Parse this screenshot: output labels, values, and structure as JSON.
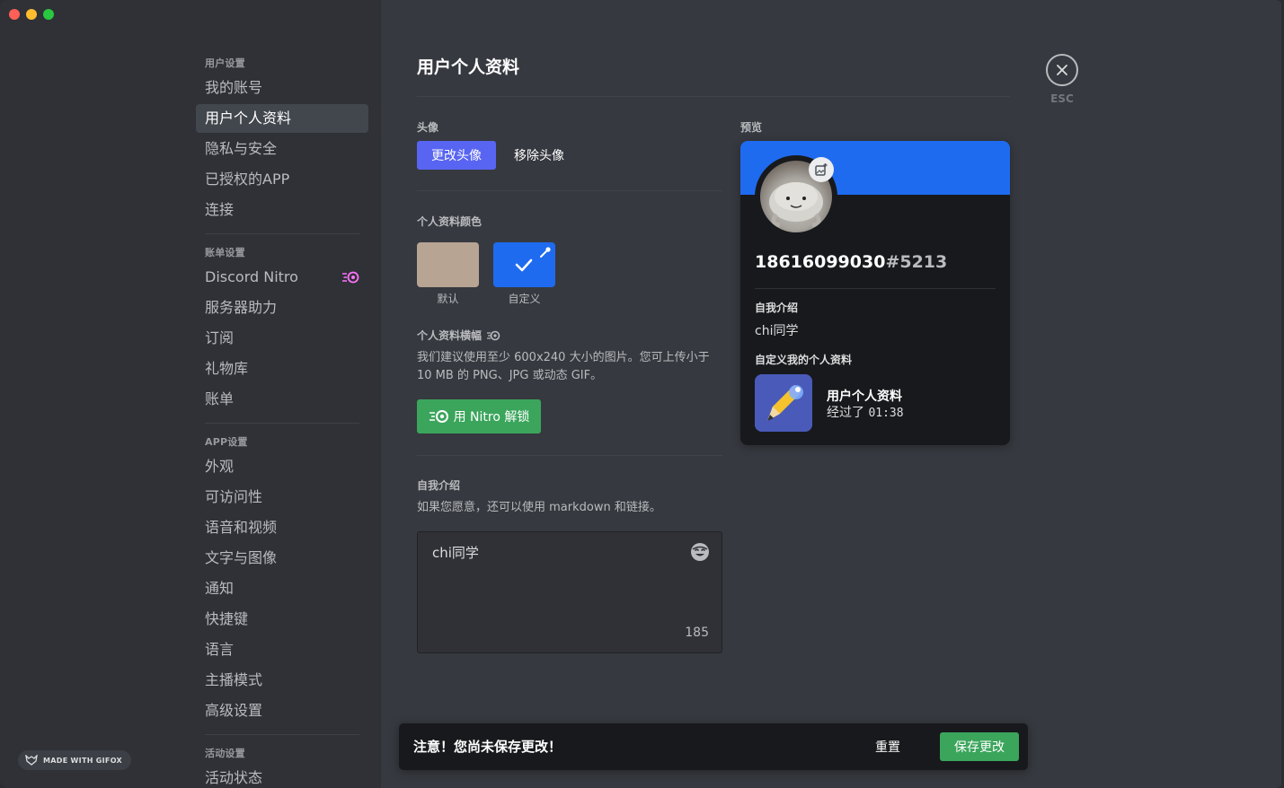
{
  "window": {
    "traffic_colors": [
      "#ff5f57",
      "#febc2e",
      "#28c840"
    ]
  },
  "sidebar": {
    "sections": [
      {
        "header": "用户设置",
        "items": [
          {
            "label": "我的账号",
            "active": false
          },
          {
            "label": "用户个人资料",
            "active": true
          },
          {
            "label": "隐私与安全",
            "active": false
          },
          {
            "label": "已授权的APP",
            "active": false
          },
          {
            "label": "连接",
            "active": false
          }
        ]
      },
      {
        "header": "账单设置",
        "items": [
          {
            "label": "Discord Nitro",
            "active": false,
            "badge": "nitro-icon"
          },
          {
            "label": "服务器助力",
            "active": false
          },
          {
            "label": "订阅",
            "active": false
          },
          {
            "label": "礼物库",
            "active": false
          },
          {
            "label": "账单",
            "active": false
          }
        ]
      },
      {
        "header": "APP设置",
        "items": [
          {
            "label": "外观",
            "active": false
          },
          {
            "label": "可访问性",
            "active": false
          },
          {
            "label": "语音和视频",
            "active": false
          },
          {
            "label": "文字与图像",
            "active": false
          },
          {
            "label": "通知",
            "active": false
          },
          {
            "label": "快捷键",
            "active": false
          },
          {
            "label": "语言",
            "active": false
          },
          {
            "label": "主播模式",
            "active": false
          },
          {
            "label": "高级设置",
            "active": false
          }
        ]
      },
      {
        "header": "活动设置",
        "items": [
          {
            "label": "活动状态",
            "active": false
          }
        ]
      }
    ],
    "gifox_badge": "MADE WITH GIFOX"
  },
  "main": {
    "title": "用户个人资料",
    "avatar": {
      "label": "头像",
      "change_button": "更改头像",
      "remove_button": "移除头像"
    },
    "profile_color": {
      "label": "个人资料颜色",
      "default_label": "默认",
      "default_color": "#b8a493",
      "custom_label": "自定义",
      "custom_color": "#1f6bf0"
    },
    "banner": {
      "label": "个人资料横幅",
      "description": "我们建议使用至少 600x240 大小的图片。您可上传小于 10 MB 的 PNG、JPG 或动态 GIF。",
      "unlock_button": "用 Nitro 解锁"
    },
    "bio": {
      "label": "自我介绍",
      "hint": "如果您愿意，还可以使用 markdown 和链接。",
      "value": "chi同学",
      "remaining": "185"
    }
  },
  "preview": {
    "label": "预览",
    "banner_color": "#1f6bf0",
    "username": "18616099030",
    "discriminator": "#5213",
    "about_label": "自我介绍",
    "about_text": "chi同学",
    "customize_label": "自定义我的个人资料",
    "activity_title": "用户个人资料",
    "activity_prefix": "经过了",
    "activity_time": "01:38"
  },
  "close": {
    "label": "ESC"
  },
  "notice": {
    "text": "注意！您尚未保存更改！",
    "reset": "重置",
    "save": "保存更改"
  }
}
